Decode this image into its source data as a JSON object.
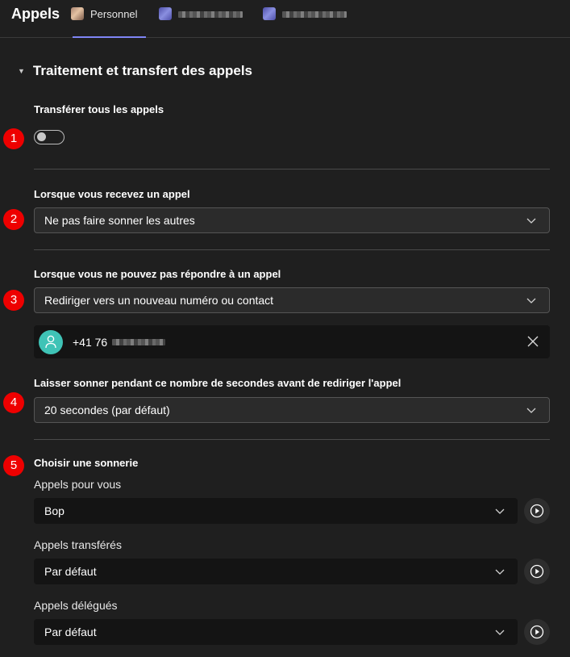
{
  "header": {
    "title": "Appels",
    "tabs": [
      {
        "label": "Personnel",
        "icon": "person-avatar",
        "active": true
      },
      {
        "label": "",
        "icon": "group-avatar",
        "active": false
      },
      {
        "label": "",
        "icon": "group-avatar",
        "active": false
      }
    ]
  },
  "section": {
    "title": "Traitement et transfert des appels",
    "expanded": true
  },
  "forward_all": {
    "badge": "1",
    "label": "Transférer tous les appels",
    "enabled": false
  },
  "on_receive": {
    "badge": "2",
    "label": "Lorsque vous recevez un appel",
    "selected": "Ne pas faire sonner les autres"
  },
  "on_unanswered": {
    "badge": "3",
    "label": "Lorsque vous ne pouvez pas répondre à un appel",
    "selected": "Rediriger vers un nouveau numéro ou contact",
    "contact_prefix": "+41 76"
  },
  "ring_duration": {
    "badge": "4",
    "label": "Laisser sonner pendant ce nombre de secondes avant de rediriger l'appel",
    "selected": "20 secondes (par défaut)"
  },
  "ringtones": {
    "badge": "5",
    "title": "Choisir une sonnerie",
    "items": [
      {
        "label": "Appels pour vous",
        "selected": "Bop"
      },
      {
        "label": "Appels transférés",
        "selected": "Par défaut"
      },
      {
        "label": "Appels délégués",
        "selected": "Par défaut"
      }
    ]
  },
  "colors": {
    "background": "#1f1f1f",
    "accent": "#7f85f5",
    "badge": "#ee0000",
    "contact_avatar": "#3fc3b6"
  }
}
